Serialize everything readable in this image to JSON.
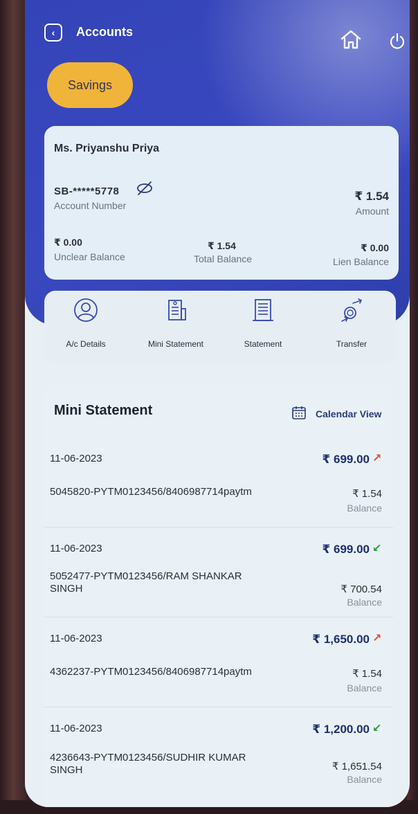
{
  "header": {
    "title": "Accounts",
    "back_icon": "chevron-left-icon",
    "home_icon": "home-icon",
    "power_icon": "power-icon"
  },
  "tabs": {
    "active": "Savings"
  },
  "account": {
    "holder_name": "Ms. Priyanshu Priya",
    "number": "SB-*****5778",
    "number_label": "Account Number",
    "amount": "₹ 1.54",
    "amount_label": "Amount",
    "unclear_balance": "₹ 0.00",
    "unclear_balance_label": "Unclear Balance",
    "total_balance": "₹ 1.54",
    "total_balance_label": "Total Balance",
    "lien_balance": "₹ 0.00",
    "lien_balance_label": "Lien Balance"
  },
  "quick_actions": [
    {
      "label": "A/c Details",
      "icon": "user-circle-icon"
    },
    {
      "label": "Mini Statement",
      "icon": "receipt-icon"
    },
    {
      "label": "Statement",
      "icon": "document-list-icon"
    },
    {
      "label": "Transfer",
      "icon": "transfer-icon"
    }
  ],
  "mini_statement": {
    "title": "Mini Statement",
    "calendar_view_label": "Calendar View",
    "transactions": [
      {
        "date": "11-06-2023",
        "amount": "₹ 699.00",
        "direction": "debit",
        "description": "5045820-PYTM0123456/8406987714paytm",
        "balance": "₹ 1.54",
        "balance_label": "Balance"
      },
      {
        "date": "11-06-2023",
        "amount": "₹ 699.00",
        "direction": "credit",
        "description": "5052477-PYTM0123456/RAM SHANKAR SINGH",
        "balance": "₹ 700.54",
        "balance_label": "Balance"
      },
      {
        "date": "11-06-2023",
        "amount": "₹ 1,650.00",
        "direction": "debit",
        "description": "4362237-PYTM0123456/8406987714paytm",
        "balance": "₹ 1.54",
        "balance_label": "Balance"
      },
      {
        "date": "11-06-2023",
        "amount": "₹ 1,200.00",
        "direction": "credit",
        "description": "4236643-PYTM0123456/SUDHIR KUMAR SINGH",
        "balance": "₹ 1,651.54",
        "balance_label": "Balance"
      }
    ]
  },
  "colors": {
    "header_blue": "#3444b8",
    "savings_accent": "#f0b43a",
    "debit_arrow": "#e04a3a",
    "credit_arrow": "#2a9a3a"
  }
}
